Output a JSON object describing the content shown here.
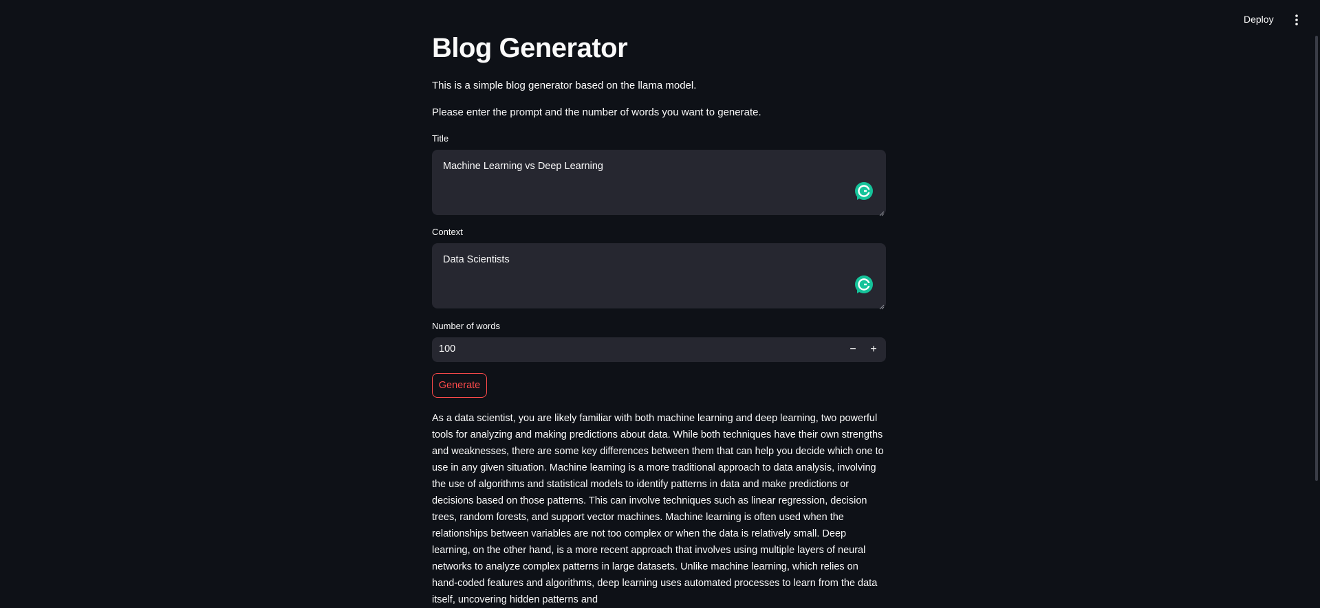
{
  "header": {
    "deploy_label": "Deploy",
    "menu_icon": "kebab-menu-icon"
  },
  "app": {
    "title": "Blog Generator",
    "intro": "This is a simple blog generator based on the llama model.",
    "instructions": "Please enter the prompt and the number of words you want to generate."
  },
  "form": {
    "title_label": "Title",
    "title_value": "Machine Learning vs Deep Learning",
    "context_label": "Context",
    "context_value": "Data Scientists",
    "words_label": "Number of words",
    "words_value": "100",
    "decrement": "−",
    "increment": "+",
    "generate_label": "Generate",
    "assistant_icon": "grammarly-icon"
  },
  "output": {
    "text": "As a data scientist, you are likely familiar with both machine learning and deep learning, two powerful tools for analyzing and making predictions about data. While both techniques have their own strengths and weaknesses, there are some key differences between them that can help you decide which one to use in any given situation. Machine learning is a more traditional approach to data analysis, involving the use of algorithms and statistical models to identify patterns in data and make predictions or decisions based on those patterns. This can involve techniques such as linear regression, decision trees, random forests, and support vector machines. Machine learning is often used when the relationships between variables are not too complex or when the data is relatively small. Deep learning, on the other hand, is a more recent approach that involves using multiple layers of neural networks to analyze complex patterns in large datasets. Unlike machine learning, which relies on hand-coded features and algorithms, deep learning uses automated processes to learn from the data itself, uncovering hidden patterns and"
  },
  "colors": {
    "background": "#0e1117",
    "input_bg": "#262730",
    "accent": "#ff4b4b",
    "grammarly": "#15c39a"
  }
}
